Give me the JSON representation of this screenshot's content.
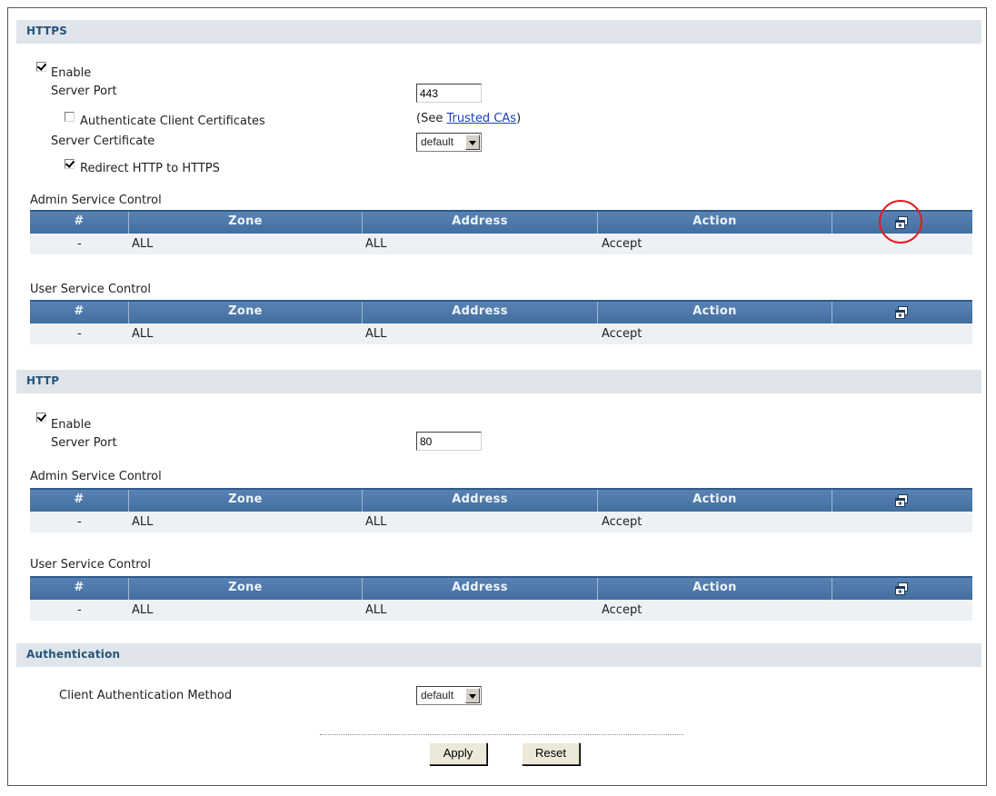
{
  "https": {
    "header": "HTTPS",
    "enable_label": "Enable",
    "enable_checked": true,
    "server_port_label": "Server Port",
    "server_port_value": "443",
    "auth_client_cert_label": "Authenticate Client Certificates",
    "auth_client_cert_checked": false,
    "see_prefix": "(See ",
    "trusted_cas_link": "Trusted CAs",
    "see_suffix": ")",
    "server_cert_label": "Server Certificate",
    "server_cert_value": "default",
    "redirect_label": "Redirect HTTP to HTTPS",
    "redirect_checked": true,
    "admin_control": {
      "title": "Admin Service Control",
      "columns": [
        "#",
        "Zone",
        "Address",
        "Action"
      ],
      "row": {
        "num": "-",
        "zone": "ALL",
        "address": "ALL",
        "action": "Accept"
      }
    },
    "user_control": {
      "title": "User Service Control",
      "columns": [
        "#",
        "Zone",
        "Address",
        "Action"
      ],
      "row": {
        "num": "-",
        "zone": "ALL",
        "address": "ALL",
        "action": "Accept"
      }
    }
  },
  "http": {
    "header": "HTTP",
    "enable_label": "Enable",
    "enable_checked": true,
    "server_port_label": "Server Port",
    "server_port_value": "80",
    "admin_control": {
      "title": "Admin Service Control",
      "columns": [
        "#",
        "Zone",
        "Address",
        "Action"
      ],
      "row": {
        "num": "-",
        "zone": "ALL",
        "address": "ALL",
        "action": "Accept"
      }
    },
    "user_control": {
      "title": "User Service Control",
      "columns": [
        "#",
        "Zone",
        "Address",
        "Action"
      ],
      "row": {
        "num": "-",
        "zone": "ALL",
        "address": "ALL",
        "action": "Accept"
      }
    }
  },
  "authentication": {
    "header": "Authentication",
    "method_label": "Client Authentication Method",
    "method_value": "default"
  },
  "buttons": {
    "apply": "Apply",
    "reset": "Reset"
  },
  "icons": {
    "add": "add-entry-icon",
    "checkbox_on": "checkmark"
  },
  "colors": {
    "header_blue": "#4a76a8",
    "section_bg": "#dfe5ea",
    "highlight_ring": "#e31b23"
  }
}
